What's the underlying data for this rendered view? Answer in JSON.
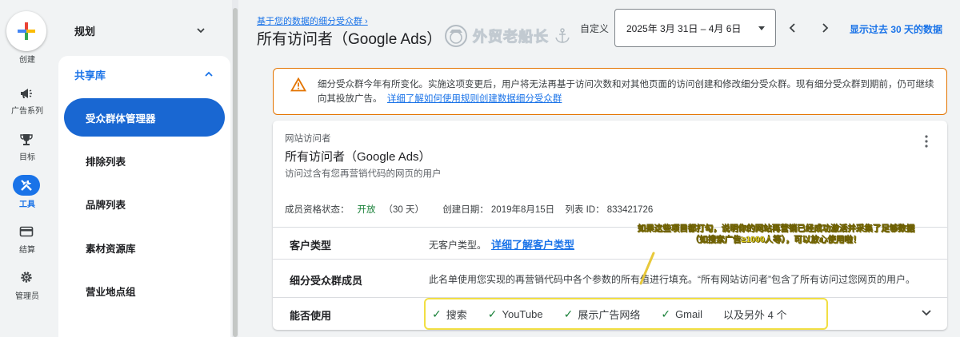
{
  "rail": {
    "create_label": "创建",
    "items": [
      {
        "label": "广告系列",
        "icon": "megaphone-icon"
      },
      {
        "label": "目标",
        "icon": "trophy-icon"
      },
      {
        "label": "工具",
        "icon": "tools-icon",
        "active": true
      },
      {
        "label": "结算",
        "icon": "credit-card-icon"
      },
      {
        "label": "管理员",
        "icon": "gear-icon"
      }
    ]
  },
  "nav": {
    "top_label": "规划",
    "section_label": "共享库",
    "items": [
      {
        "label": "受众群体管理器",
        "active": true
      },
      {
        "label": "排除列表"
      },
      {
        "label": "品牌列表"
      },
      {
        "label": "素材资源库"
      },
      {
        "label": "营业地点组"
      }
    ]
  },
  "header": {
    "breadcrumb": "基于您的数据的细分受众群 ›",
    "title": "所有访问者（Google Ads）",
    "watermark": "外贸老船长",
    "custom_label": "自定义",
    "date_range": "2025年 3月 31日 – 4月 6日",
    "last30_label": "显示过去 30 天的数据"
  },
  "warning": {
    "text": "细分受众群今年有所变化。实施这项变更后，用户将无法再基于访问次数和对其他页面的访问创建和修改细分受众群。现有细分受众群到期前，仍可继续向其投放广告。",
    "link": "详细了解如何使用规则创建数据细分受众群"
  },
  "audience": {
    "type": "网站访问者",
    "name": "所有访问者（Google Ads）",
    "description": "访问过含有您再营销代码的网页的用户",
    "status_label": "成员资格状态：",
    "status_value": "开放",
    "status_duration": "（30 天）",
    "created": "创建日期：  2019年8月15日",
    "list_id": "列表 ID：  833421726",
    "rows": {
      "customer_type_label": "客户类型",
      "customer_type_value": "无客户类型。",
      "customer_type_link": "详细了解客户类型",
      "members_label": "细分受众群成员",
      "members_value": "此名单使用您实现的再营销代码中各个参数的所有值进行填充。“所有网站访问者”包含了所有访问过您网页的用户。",
      "usage_label": "能否使用",
      "usage_items": [
        "搜索",
        "YouTube",
        "展示广告网络",
        "Gmail"
      ],
      "usage_more": "以及另外 4 个"
    }
  },
  "annotation": {
    "line1": "如果这些项目都打勾，说明你的网站再营销已经成功激活并采集了足够数据",
    "line2": "（如搜索广告≥1000人等），可以放心使用啦！"
  },
  "colors": {
    "accent": "#1a73e8",
    "active_nav": "#1967d2",
    "success": "#188038",
    "warning_border": "#e37400",
    "highlight": "#f2df43"
  }
}
